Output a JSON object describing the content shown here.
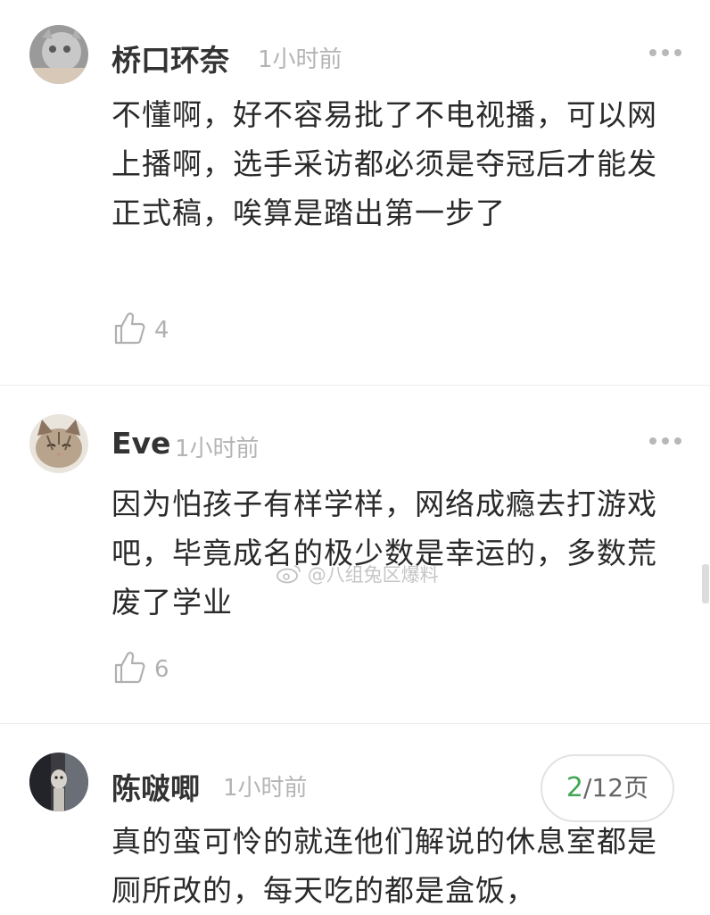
{
  "comments": [
    {
      "user": "桥口环奈",
      "time": "1小时前",
      "text": "不懂啊，好不容易批了不电视播，可以网上播啊，选手采访都必须是夺冠后才能发正式稿，唉算是踏出第一步了",
      "likes": "4",
      "avatar_icon": "avatar-gray-cat"
    },
    {
      "user": "Eve",
      "time": "1小时前",
      "text": "因为怕孩子有样学样，网络成瘾去打游戏吧，毕竟成名的极少数是幸运的，多数荒废了学业",
      "likes": "6",
      "avatar_icon": "avatar-tabby-cat"
    },
    {
      "user": "陈啵唧",
      "time": "1小时前",
      "text": "真的蛮可怜的就连他们解说的休息室都是厕所改的，每天吃的都是盒饭，",
      "avatar_icon": "avatar-dark-photo"
    }
  ],
  "watermark": "@八组兔区爆料",
  "pager": {
    "current": "2",
    "total": "/12页"
  },
  "icons": {
    "like": "thumbs-up-icon",
    "more": "more-dots-icon",
    "weibo": "weibo-icon"
  },
  "colors": {
    "accent": "#42a653",
    "meta": "#b4b4b4",
    "text": "#2a2a2a"
  }
}
